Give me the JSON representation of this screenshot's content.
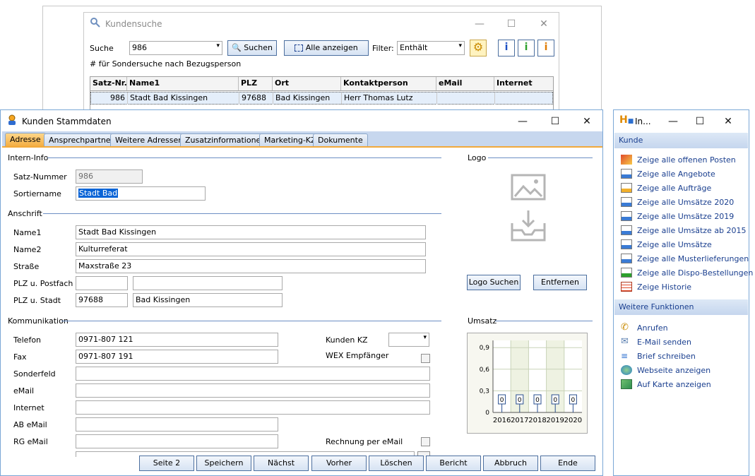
{
  "search_window": {
    "title": "Kundensuche",
    "search_label": "Suche",
    "search_value": "986",
    "search_button": "Suchen",
    "show_all_button": "Alle anzeigen",
    "filter_label": "Filter:",
    "filter_value": "Enthält",
    "hint": "# für Sondersuche nach Bezugsperson",
    "columns": [
      "Satz-Nr.",
      "Name1",
      "PLZ",
      "Ort",
      "Kontaktperson",
      "eMail",
      "Internet"
    ],
    "row": {
      "satz": "986",
      "name1": "Stadt Bad Kissingen",
      "plz": "97688",
      "ort": "Bad Kissingen",
      "kontakt": "Herr Thomas Lutz",
      "email": "",
      "internet": ""
    }
  },
  "main_window": {
    "title": "Kunden Stammdaten",
    "tabs": [
      "Adresse",
      "Ansprechpartner",
      "Weitere Adressen",
      "Zusatzinformationen",
      "Marketing-KZ",
      "Dokumente"
    ],
    "sections": {
      "intern": "Intern-Info",
      "anschrift": "Anschrift",
      "kommunikation": "Kommunikation",
      "logo": "Logo",
      "umsatz": "Umsatz"
    },
    "fields": {
      "satz_label": "Satz-Nummer",
      "satz_value": "986",
      "sortier_label": "Sortiername",
      "sortier_value": "Stadt Bad",
      "name1_label": "Name1",
      "name1_value": "Stadt Bad Kissingen",
      "name2_label": "Name2",
      "name2_value": "Kulturreferat",
      "strasse_label": "Straße",
      "strasse_value": "Maxstraße 23",
      "postfach_label": "PLZ u. Postfach",
      "postfach_plz": "",
      "postfach_value": "",
      "stadt_label": "PLZ u. Stadt",
      "stadt_plz": "97688",
      "stadt_value": "Bad Kissingen",
      "telefon_label": "Telefon",
      "telefon_value": "0971-807 121",
      "fax_label": "Fax",
      "fax_value": "0971-807 191",
      "sonderfeld_label": "Sonderfeld",
      "sonderfeld_value": "",
      "email_label": "eMail",
      "email_value": "",
      "internet_label": "Internet",
      "internet_value": "",
      "abemail_label": "AB eMail",
      "abemail_value": "",
      "rgemail_label": "RG eMail",
      "rgemail_value": "",
      "kundenkz_label": "Kunden KZ",
      "kundenkz_value": "",
      "wex_label": "WEX Empfänger",
      "rechnung_label": "Rechnung per eMail"
    },
    "logo_search_button": "Logo Suchen",
    "logo_remove_button": "Entfernen",
    "bottom_buttons": [
      "Seite 2",
      "Speichern",
      "Nächst",
      "Vorher",
      "Löschen",
      "Bericht",
      "Abbruch",
      "Ende"
    ]
  },
  "chart_data": {
    "type": "bar",
    "categories": [
      "2016",
      "2017",
      "2018",
      "2019",
      "2020"
    ],
    "values": [
      0,
      0,
      0,
      0,
      0
    ],
    "data_labels": [
      "0",
      "0",
      "0",
      "0",
      "0"
    ],
    "ylim": [
      0,
      1.0
    ],
    "yticks": [
      0,
      0.3,
      0.6,
      0.9
    ],
    "ytick_labels": [
      "0",
      "0,3",
      "0,6",
      "0,9"
    ],
    "grid": true
  },
  "side_panel": {
    "title": "In...",
    "kunde_header": "Kunde",
    "kunde_items": [
      "Zeige alle offenen Posten",
      "Zeige alle Angebote",
      "Zeige alle Aufträge",
      "Zeige alle Umsätze 2020",
      "Zeige alle Umsätze 2019",
      "Zeige alle Umsätze ab 2015",
      "Zeige alle Umsätze",
      "Zeige alle Musterlieferungen",
      "Zeige alle Dispo-Bestellungen",
      "Zeige Historie"
    ],
    "weitere_header": "Weitere Funktionen",
    "weitere_items": [
      "Anrufen",
      "E-Mail senden",
      "Brief schreiben",
      "Webseite anzeigen",
      "Auf Karte anzeigen"
    ]
  }
}
